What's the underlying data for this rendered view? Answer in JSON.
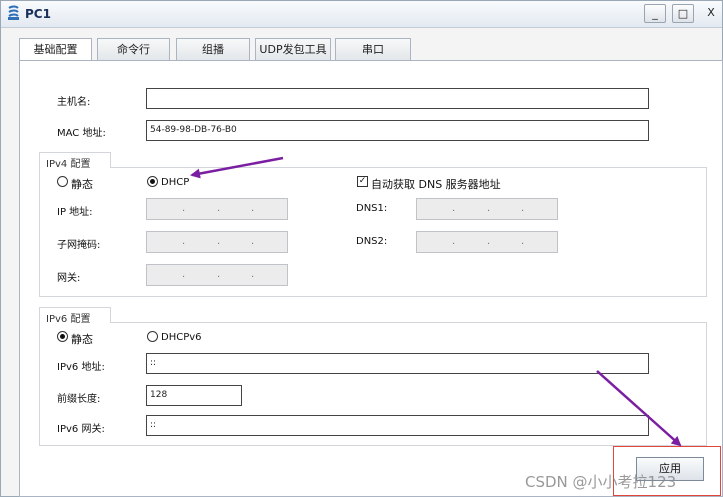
{
  "window": {
    "title": "PC1",
    "minimize_label": "_",
    "maximize_label": "□",
    "close_label": "X"
  },
  "tabs": [
    {
      "label": "基础配置",
      "active": true
    },
    {
      "label": "命令行",
      "active": false
    },
    {
      "label": "组播",
      "active": false
    },
    {
      "label": "UDP发包工具",
      "active": false
    },
    {
      "label": "串口",
      "active": false
    }
  ],
  "host": {
    "hostname_label": "主机名:",
    "hostname_value": "",
    "mac_label": "MAC 地址:",
    "mac_value": "54-89-98-DB-76-B0"
  },
  "ipv4": {
    "group_title": "IPv4 配置",
    "static_label": "静态",
    "dhcp_label": "DHCP",
    "selected_mode": "DHCP",
    "auto_dns_label": "自动获取 DNS 服务器地址",
    "auto_dns_checked": true,
    "ip_label": "IP 地址:",
    "mask_label": "子网掩码:",
    "gateway_label": "网关:",
    "dns1_label": "DNS1:",
    "dns2_label": "DNS2:",
    "ip_dots": ".",
    "mask_dots": ".",
    "gateway_dots": ".",
    "dns1_dots": ".",
    "dns2_dots": "."
  },
  "ipv6": {
    "group_title": "IPv6 配置",
    "static_label": "静态",
    "dhcpv6_label": "DHCPv6",
    "selected_mode": "静态",
    "address_label": "IPv6 地址:",
    "address_value": "::",
    "prefix_label": "前缀长度:",
    "prefix_value": "128",
    "gateway_label": "IPv6 网关:",
    "gateway_value": "::"
  },
  "apply_label": "应用",
  "watermark": "CSDN @小小考拉123",
  "colors": {
    "annotation_arrow": "#7b1fa2",
    "highlight_box": "#e0463b",
    "title_text": "#1a2f5a"
  }
}
